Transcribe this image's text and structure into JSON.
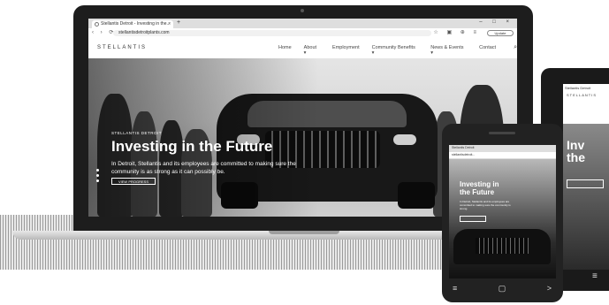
{
  "laptop_browser": {
    "tab_title": "Stellantis Detroit - Investing in the...",
    "tab_close": "×",
    "new_tab": "+",
    "window_controls": "–  □  ×",
    "nav_icons": "‹ › ⟳ ⌂",
    "url": "stellantisdetroitplants.com",
    "ext_icons": "☆ ▣ ⊕ ≡",
    "update_label": "Update"
  },
  "site": {
    "logo": "STELLANTIS",
    "menu": [
      "Home",
      "About ▾",
      "Employment",
      "Community Benefits ▾",
      "News & Events ▾",
      "Contact"
    ],
    "search_glyph": "⌕",
    "hero": {
      "eyebrow": "STELLANTIS DETROIT",
      "title": "Investing in the Future",
      "subtitle": "In Detroit, Stellantis and its employees are committed to making sure the community is as strong as it can possibly be.",
      "cta": "VIEW PROGRESS"
    }
  },
  "phone": {
    "tab_title": "Stellantis Detroit",
    "url": "stellantisdetroit...",
    "title_line1": "Investing in",
    "title_line2": "the Future",
    "subtitle": "In Detroit, Stellantis and its employees are committed to making sure the community is strong.",
    "nav_back": "≡",
    "nav_home": "▢",
    "nav_recent": ">"
  },
  "tablet": {
    "tab_title": "Stellantis Detroit",
    "logo": "STELLANTIS",
    "title_line1": "Inv",
    "title_line2": "the",
    "menu_glyph": "≡"
  }
}
